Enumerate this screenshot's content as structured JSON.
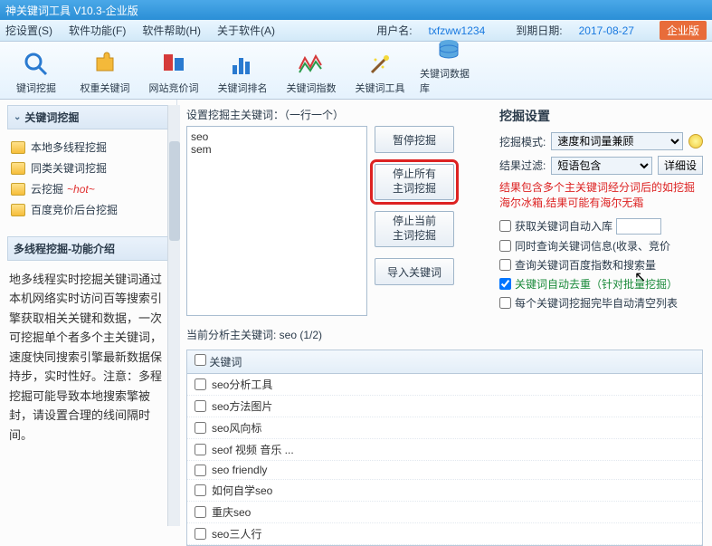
{
  "window": {
    "title": "神关键词工具 V10.3-企业版"
  },
  "menu": {
    "items": [
      "挖设置(S)",
      "软件功能(F)",
      "软件帮助(H)",
      "关于软件(A)"
    ],
    "user_label": "用户名:",
    "user_value": "txfzww1234",
    "expire_label": "到期日期:",
    "expire_value": "2017-08-27",
    "enterprise": "企业版"
  },
  "toolbar": {
    "items": [
      {
        "label": "键词挖掘",
        "glyph": "search"
      },
      {
        "label": "权重关键词",
        "glyph": "puzzle"
      },
      {
        "label": "网站竞价词",
        "glyph": "tools"
      },
      {
        "label": "关键词排名",
        "glyph": "chart"
      },
      {
        "label": "关键词指数",
        "glyph": "wave"
      },
      {
        "label": "关键词工具",
        "glyph": "wand"
      },
      {
        "label": "关键词数据库",
        "glyph": "db"
      }
    ]
  },
  "sidebar": {
    "panel_title": "关键词挖掘",
    "tree": [
      {
        "label": "本地多线程挖掘",
        "hot": false
      },
      {
        "label": "同类关键词挖掘",
        "hot": false
      },
      {
        "label": "云挖掘",
        "hot": true,
        "hot_text": "~hot~"
      },
      {
        "label": "百度竞价后台挖掘",
        "hot": false
      }
    ],
    "sub_title": "多线程挖掘-功能介绍",
    "description": "地多线程实时挖掘关键词通过本机网络实时访问百等搜索引擎获取相关关键和数据，一次可挖掘单个者多个主关键词，速度快同搜索引擎最新数据保持步，实时性好。注意：多程挖掘可能导致本地搜索擎被封，请设置合理的线间隔时间。"
  },
  "main": {
    "seed_label": "设置挖掘主关键词：（一行一个）",
    "seed_value": "seo\nsem",
    "buttons": {
      "pause": "暂停挖掘",
      "stop_all": "停止所有\n主词挖掘",
      "stop_current": "停止当前\n主词挖掘",
      "import": "导入关键词"
    },
    "settings": {
      "title": "挖掘设置",
      "mode_label": "挖掘模式:",
      "mode_value": "速度和词量兼顾",
      "filter_label": "结果过滤:",
      "filter_value": "短语包含",
      "detail_btn": "详细设",
      "warn": "结果包含多个主关键词经分词后的如挖掘海尔冰箱,结果可能有海尔无霜",
      "chk_auto_store": "获取关键词自动入库",
      "chk_query_info": "同时查询关键词信息(收录、竞价",
      "chk_query_index": "查询关键词百度指数和搜索量",
      "chk_dedup": "关键词自动去重（针对批量挖掘）",
      "chk_clear": "每个关键词挖掘完毕自动清空列表"
    },
    "status": "当前分析主关键词: seo (1/2)",
    "table": {
      "header": "关键词",
      "rows": [
        "seo分析工具",
        "seo方法图片",
        "seo风向标",
        "seof 视频 音乐 ...",
        "seo friendly",
        "如何自学seo",
        "重庆seo",
        "seo三人行"
      ]
    }
  }
}
